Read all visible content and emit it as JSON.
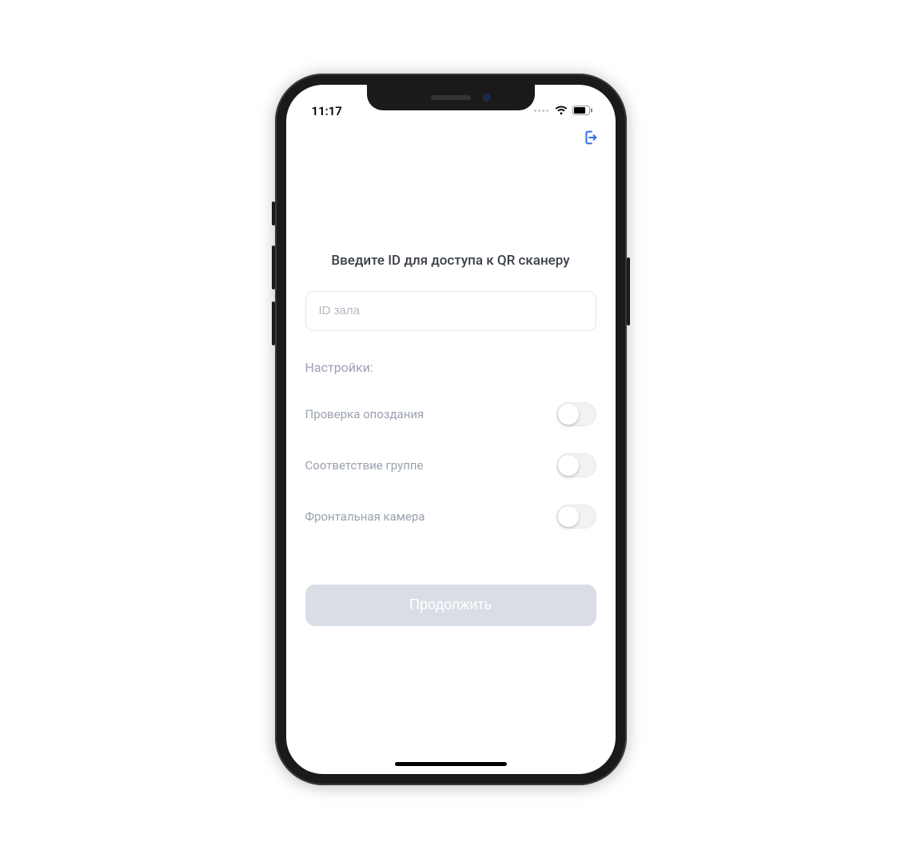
{
  "status_bar": {
    "time": "11:17"
  },
  "nav": {
    "exit_icon": "exit"
  },
  "heading": "Введите ID для доступа к QR сканеру",
  "input": {
    "placeholder": "ID зала",
    "value": ""
  },
  "settings": {
    "label": "Настройки:",
    "items": [
      {
        "label": "Проверка опоздания",
        "on": false
      },
      {
        "label": "Соответствие группе",
        "on": false
      },
      {
        "label": "Фронтальная камера",
        "on": false
      }
    ]
  },
  "continue_label": "Продолжить",
  "colors": {
    "accent": "#2f6fed",
    "muted_text": "#9aa2af",
    "button_disabled_bg": "#d9dee6"
  }
}
